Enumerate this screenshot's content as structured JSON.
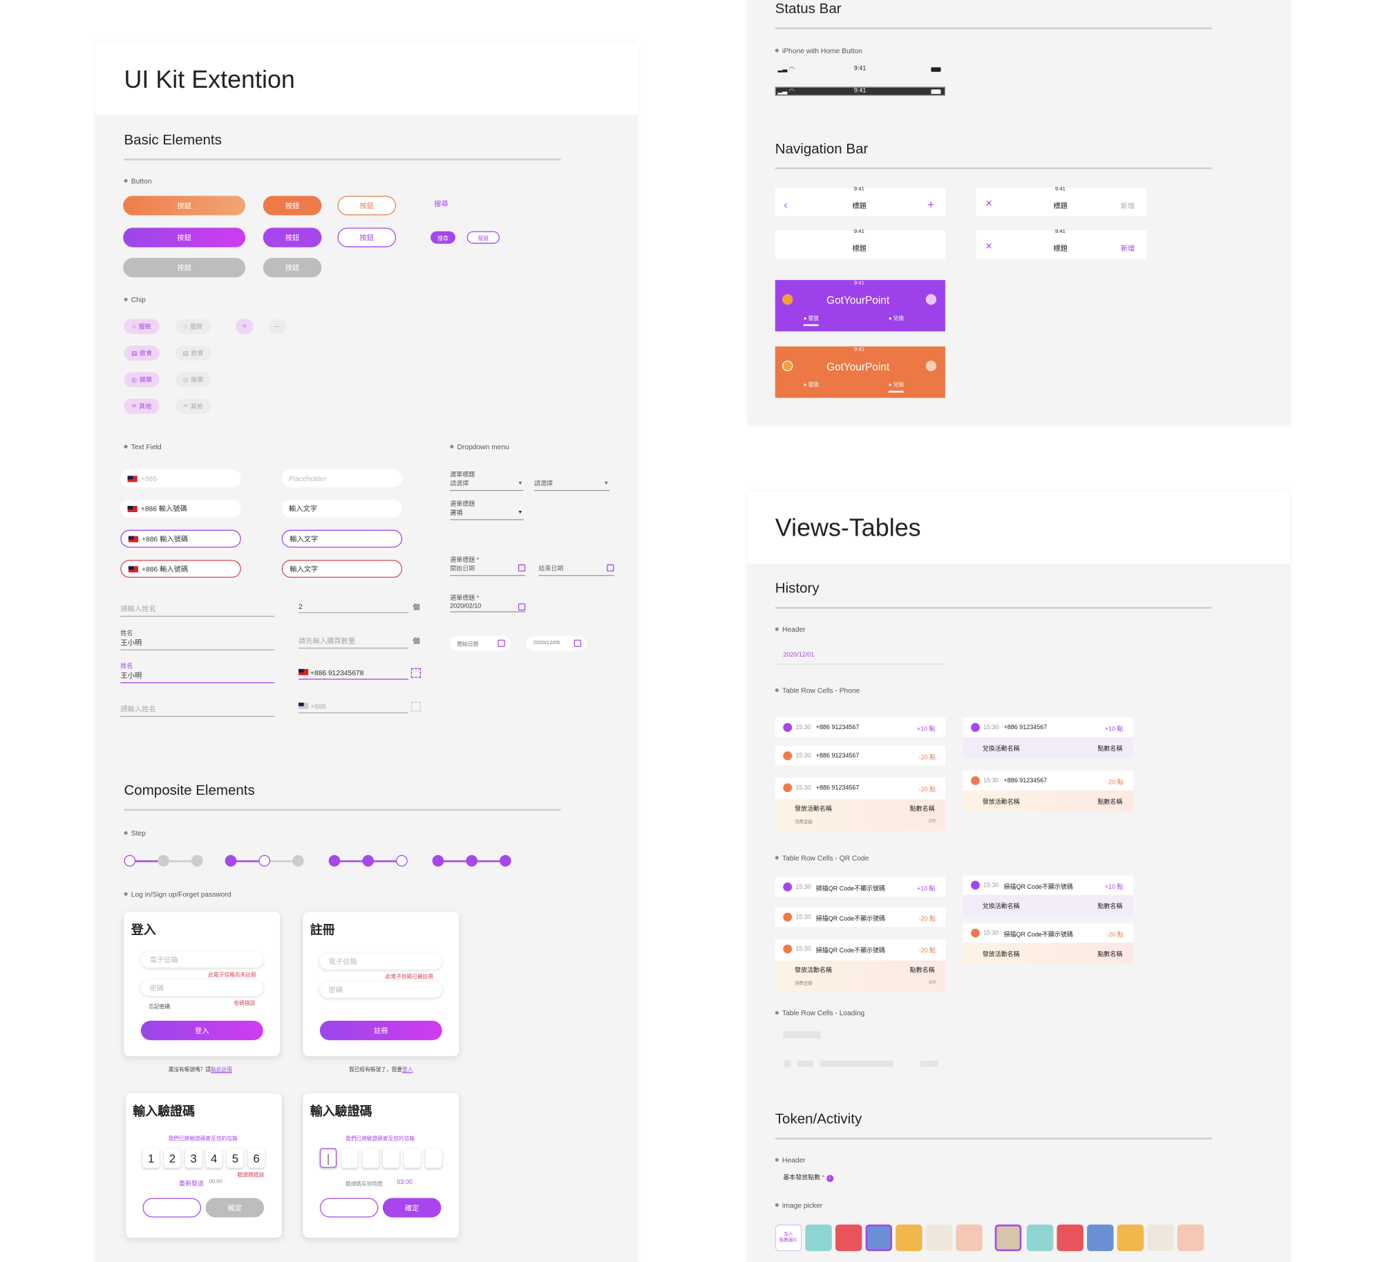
{
  "left_panel": {
    "title": "UI Kit Extention",
    "basic_title": "Basic Elements",
    "composite_title": "Composite Elements",
    "button_label": "Button",
    "button_text": "按鈕",
    "search_text": "搜尋",
    "small_search": "搜尋",
    "small_btn": "按鈕",
    "chip_label": "Chip",
    "chips": [
      "服裝",
      "飲食",
      "娛樂",
      "其他"
    ],
    "chip_equal": "=",
    "chip_dash": "—",
    "textfield_label": "Text Field",
    "dropdown_label": "Dropdown menu",
    "phone_ph": "+886",
    "phone_input": "+886  輸入號碼",
    "placeholder": "Placeholder",
    "input_text": "輸入文字",
    "name_ph": "請輸入姓名",
    "name_label": "姓名",
    "name_value": "王小明",
    "qty_value": "2",
    "qty_unit": "個",
    "qty_ph": "請先輸入購買數量",
    "phone_full": "+886  912345678",
    "phone_disabled": "+886",
    "dd_title": "選單標題",
    "dd_ph": "請選擇",
    "dd_option": "選項",
    "dd_req": "選單標題 *",
    "start_date": "開始日期",
    "end_date": "結束日期",
    "date_value": "2020/02/10",
    "pill_start": "開始日期",
    "pill_date": "2020/12/05",
    "step_label": "Step",
    "login_label": "Log in/Sign up/Forget password",
    "login_title": "登入",
    "signup_title": "註冊",
    "email_ph": "電子信箱",
    "pwd_ph": "密碼",
    "email_err_login": "此電子信箱尚未註冊",
    "pwd_err": "密碼錯誤",
    "forgot": "忘記密碼",
    "email_err_signup": "此電子信箱已被註冊",
    "login_btn": "登入",
    "signup_btn": "註冊",
    "no_account": "還沒有帳號嗎？請",
    "no_account_link": "點此註冊",
    "have_account": "我已經有帳號了，我要",
    "have_account_link": "登入",
    "verify_title": "輸入驗證碼",
    "verify_sent": "我們已將驗證碼寄至您的信箱",
    "digits": [
      "1",
      "2",
      "3",
      "4",
      "5",
      "6"
    ],
    "code_err": "驗證碼錯誤",
    "resend": "重新發送",
    "resend_time": "00:00",
    "valid_time_label": "驗證碼有效時間",
    "valid_time": "03:00",
    "back_btn": "返回",
    "confirm_btn": "確定"
  },
  "right_top": {
    "status_title": "Status Bar",
    "status_sub": "iPhone with Home Button",
    "time": "9:41",
    "nav_title": "Navigation Bar",
    "nav_label": "標題",
    "nav_add": "新增",
    "brand": "GotYourPoint",
    "tab_issue": "發放",
    "tab_redeem": "兌換"
  },
  "right_bottom": {
    "title": "Views-Tables",
    "history": "History",
    "header_label": "Header",
    "header_date": "2020/12/01",
    "phone_cells_label": "Table Row Cells - Phone",
    "qr_cells_label": "Table Row Cells - QR Code",
    "loading_label": "Table Row Cells - Loading",
    "time": "15:30",
    "phone": "+886 91234567",
    "qr_text": "掃描QR Code不顯示號碼",
    "plus": "+10 點",
    "minus": "-20 點",
    "redeem_name": "兌換活動名稱",
    "point_name": "點數名稱",
    "issue_name": "發放活動名稱",
    "spend": "消費金額",
    "spend_val": "100",
    "token_title": "Token/Activity",
    "token_header_label": "Header",
    "token_header": "基本發放點數",
    "image_picker": "image picker",
    "add_image": "加入\n點數圖片",
    "token_icons": [
      "gift-icon",
      "cosmetics-icon",
      "utensils-icon",
      "coin-icon",
      "coffee-icon",
      "cake-icon"
    ],
    "colors": {
      "purple": "#a646ec",
      "orange": "#ee7a4a"
    }
  }
}
